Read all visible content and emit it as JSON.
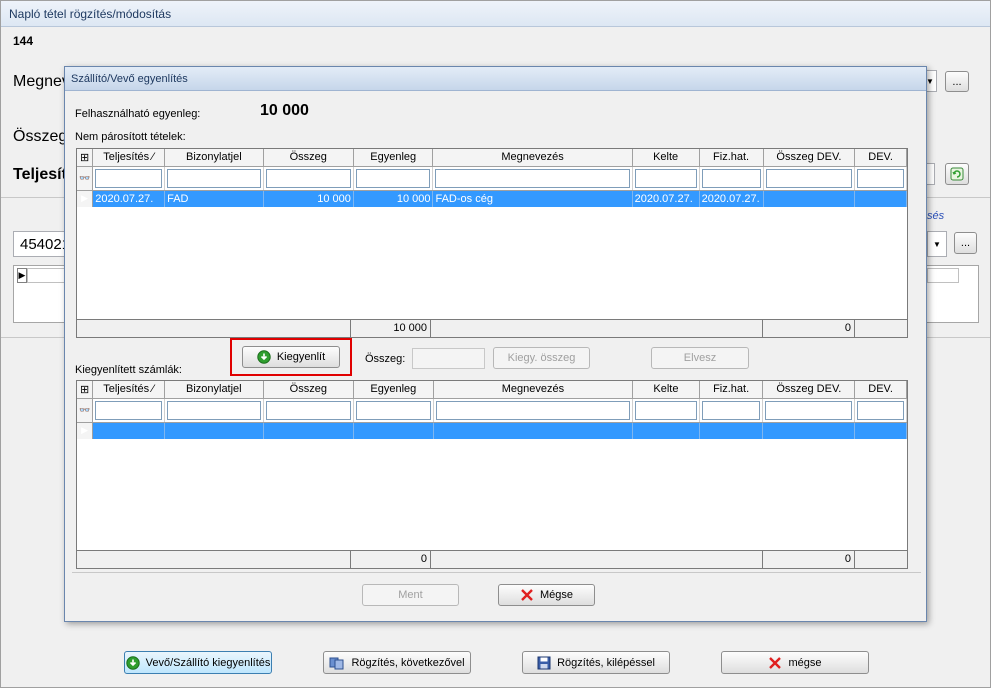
{
  "outer": {
    "title": "Napló tétel rögzítés/módosítás",
    "record_number": "144",
    "label_megnev": "Megnev",
    "label_osszeg": "Összeg",
    "label_teljesit": "Teljesít",
    "account_value": "454021",
    "link_text": "sés",
    "ellipsis": "...",
    "buttons": {
      "settle": "Vevő/Szállító kiegyenlítés",
      "record_next": "Rögzítés, következővel",
      "record_exit": "Rögzítés, kilépéssel",
      "cancel": "mégse"
    }
  },
  "dialog": {
    "title": "Szállító/Vevő egyenlítés",
    "available_balance_label": "Felhasználható egyenleg:",
    "available_balance_value": "10 000",
    "unpaired_label": "Nem párosított tételek:",
    "settled_label": "Kiegyenlített számlák:",
    "columns": [
      "Teljesítés",
      "Bizonylatjel",
      "Összeg",
      "Egyenleg",
      "Megnevezés",
      "Kelte",
      "Fiz.hat.",
      "Összeg DEV.",
      "DEV."
    ],
    "unpaired_rows": [
      {
        "teljesites": "2020.07.27.",
        "bizonylatjel": "FAD",
        "osszeg": "10 000",
        "egyenleg": "10 000",
        "megnevezes": "FAD-os cég",
        "kelte": "2020.07.27.",
        "fizhat": "2020.07.27.",
        "osszeg_dev": "",
        "dev": ""
      }
    ],
    "unpaired_footer": {
      "egyenleg_total": "10 000",
      "osszeg_dev_total": "0"
    },
    "settled_footer": {
      "egyenleg_total": "0",
      "osszeg_dev_total": "0"
    },
    "settle_button": "Kiegyenlít",
    "amount_label": "Összeg:",
    "amount_value": "",
    "settle_amount_button": "Kiegy. összeg",
    "remove_button": "Elvesz",
    "save_button": "Ment",
    "cancel_button": "Mégse"
  },
  "colors": {
    "selection": "#3399ff",
    "highlight_frame": "#e00000",
    "accent_green": "#2f9e2f",
    "cancel_red": "#e02020"
  }
}
